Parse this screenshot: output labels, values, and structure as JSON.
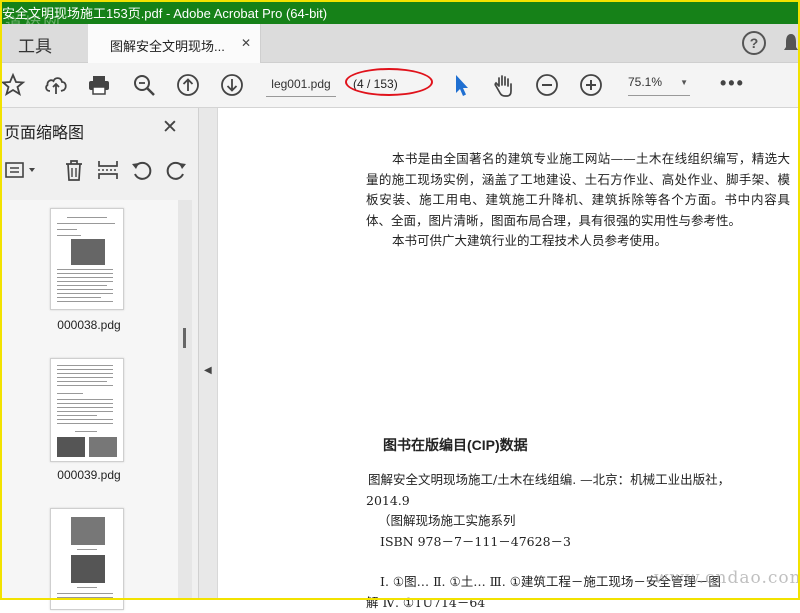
{
  "window": {
    "title": "安全文明现场施工153页.pdf - Adobe Acrobat Pro (64-bit)",
    "watermark": "道桥网"
  },
  "tabs": {
    "tools_label": "工具",
    "doc_tab_label": "图解安全文明现场...",
    "close_glyph": "✕",
    "help_glyph": "?"
  },
  "toolbar": {
    "filename": "leg001.pdg",
    "page_display": "(4 / 153)",
    "zoom": "75.1%",
    "more_glyph": "•••",
    "icons": [
      "star-icon",
      "cloud-upload-icon",
      "print-icon",
      "zoom-search-icon",
      "page-up-icon",
      "page-down-icon",
      "select-arrow-icon",
      "hand-icon",
      "zoom-out-icon",
      "zoom-in-icon"
    ]
  },
  "left_pane": {
    "title": "页面缩略图",
    "close_glyph": "✕",
    "thumbnails": [
      {
        "caption": "000038.pdg"
      },
      {
        "caption": "000039.pdg"
      },
      {
        "caption": ""
      }
    ]
  },
  "document": {
    "intro_paragraphs": [
      "本书是由全国著名的建筑专业施工网站——土木在线组织编写，精选大量的施工现场实例，涵盖了工地建设、土石方作业、高处作业、脚手架、模板安装、施工用电、建筑施工升降机、建筑拆除等各个方面。书中内容具体、全面，图片清晰，图面布局合理，具有很强的实用性与参考性。",
      "本书可供广大建筑行业的工程技术人员参考使用。"
    ],
    "cip_heading": "图书在版编目(CIP)数据",
    "cip_lines": [
      "图解安全文明现场施工/土木在线组编. —北京：机械工业出版社，",
      "2014.9",
      "（图解现场施工实施系列",
      "ISBN 978－7－111－47628－3",
      "",
      "Ⅰ. ①图…   Ⅱ. ①土…   Ⅲ. ①建筑工程－施工现场－安全管理－图",
      "解   Ⅳ. ①TU714－64"
    ]
  },
  "site_watermark": "www.cndao.com"
}
